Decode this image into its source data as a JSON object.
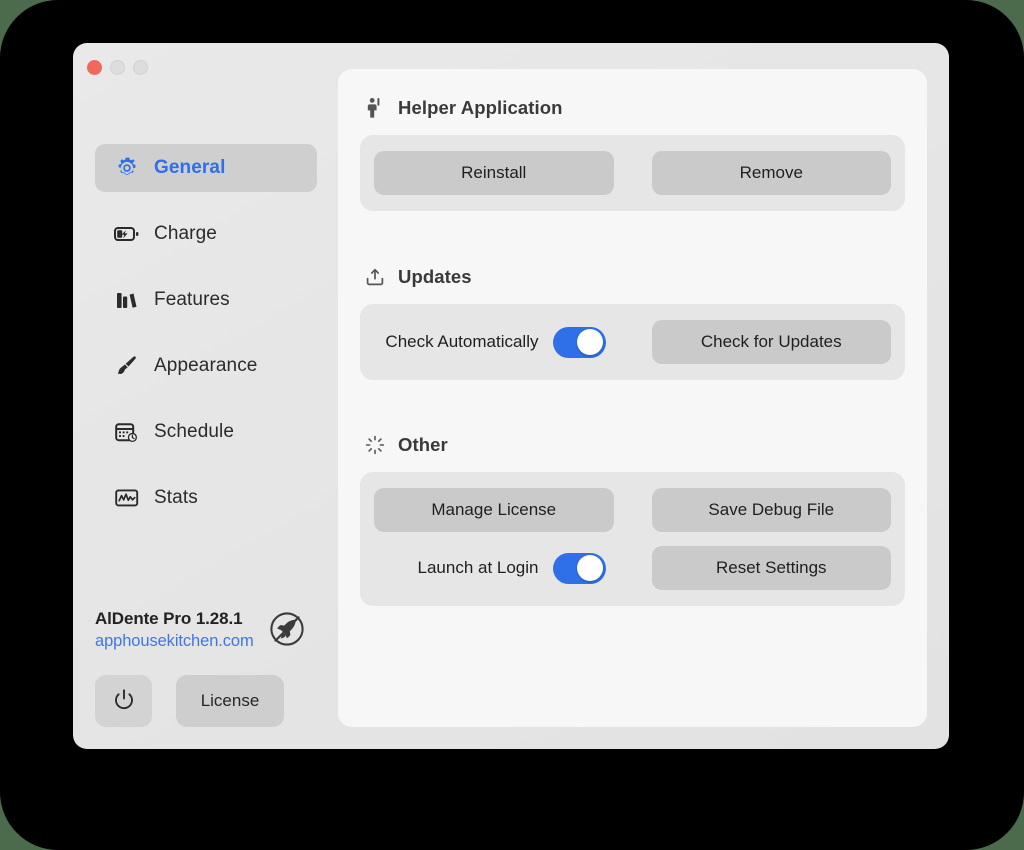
{
  "window": {
    "traffic_lights": [
      "close",
      "minimize",
      "maximize"
    ]
  },
  "sidebar": {
    "items": [
      {
        "label": "General",
        "icon": "gear-icon",
        "selected": true
      },
      {
        "label": "Charge",
        "icon": "battery-bolt-icon",
        "selected": false
      },
      {
        "label": "Features",
        "icon": "books-icon",
        "selected": false
      },
      {
        "label": "Appearance",
        "icon": "paintbrush-icon",
        "selected": false
      },
      {
        "label": "Schedule",
        "icon": "calendar-clock-icon",
        "selected": false
      },
      {
        "label": "Stats",
        "icon": "waveform-icon",
        "selected": false
      }
    ],
    "footer": {
      "app_name": "AlDente Pro 1.28.1",
      "website": "apphousekitchen.com",
      "logo_icon": "rocket-circle-icon",
      "power_icon": "power-icon",
      "license_label": "License"
    }
  },
  "main": {
    "sections": [
      {
        "title": "Helper Application",
        "icon": "person-raised-hand-icon",
        "buttons": [
          "Reinstall",
          "Remove"
        ]
      },
      {
        "title": "Updates",
        "icon": "tray-arrow-down-icon",
        "toggle_label": "Check Automatically",
        "toggle_on": true,
        "button": "Check for Updates"
      },
      {
        "title": "Other",
        "icon": "spinner-rays-icon",
        "row1_left": "Manage License",
        "row1_right": "Save Debug File",
        "toggle_label": "Launch at Login",
        "toggle_on": true,
        "row2_right": "Reset Settings"
      }
    ]
  },
  "colors": {
    "accent_blue": "#2f6fe8",
    "link_blue": "#3b77ea",
    "close_red": "#ef6a5d",
    "window_bg": "#e6e6e6",
    "panel_bg": "#f7f7f7",
    "card_bg": "#e6e6e6",
    "button_bg": "#cacaca",
    "desktop_bg": "#4c6b4c"
  }
}
